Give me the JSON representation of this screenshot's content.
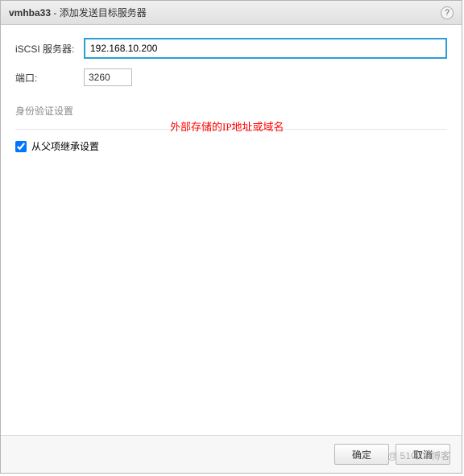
{
  "dialog": {
    "adapter_name": "vmhba33",
    "title_suffix": " - 添加发送目标服务器"
  },
  "help_tooltip": "?",
  "form": {
    "iscsi_label": "iSCSI 服务器:",
    "iscsi_value": "192.168.10.200",
    "port_label": "端口:",
    "port_value": "3260"
  },
  "auth_section": {
    "heading": "身份验证设置",
    "inherit_label": "从父项继承设置",
    "inherit_checked": true
  },
  "annotation": "外部存储的IP地址或域名",
  "buttons": {
    "ok": "确定",
    "cancel": "取消"
  },
  "watermark": "@ 51CTO博客"
}
